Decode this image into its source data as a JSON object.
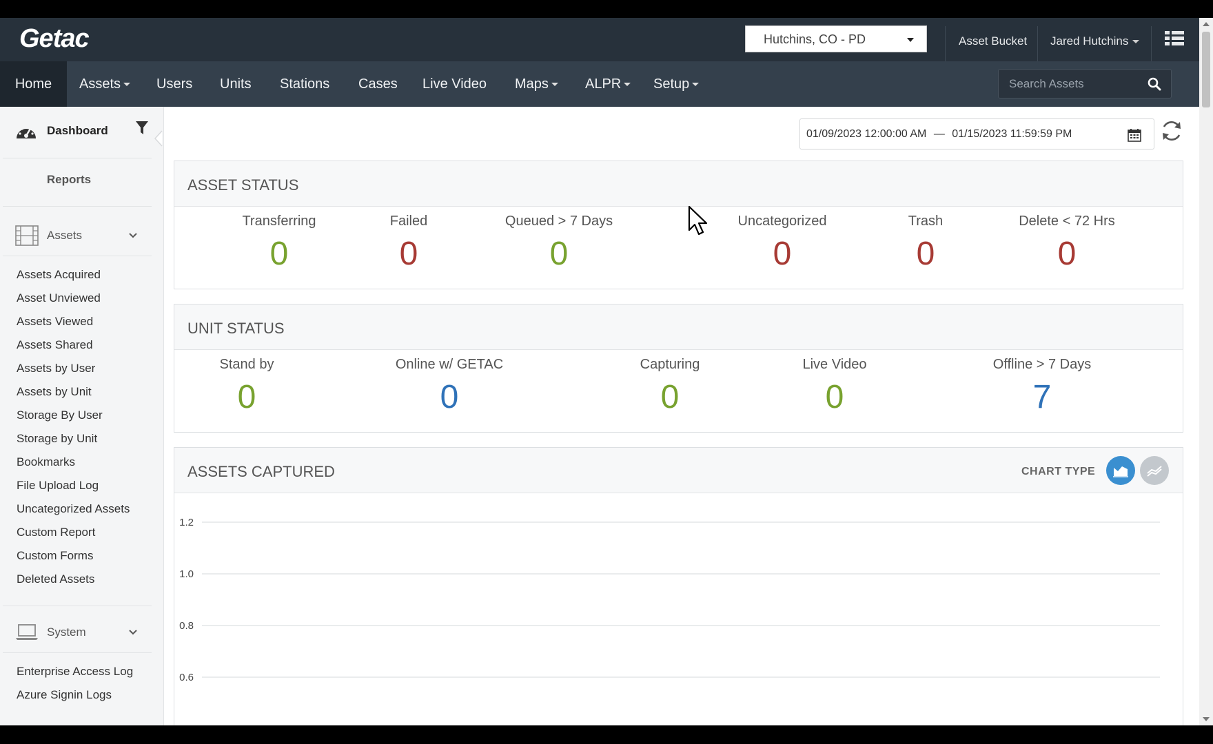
{
  "header": {
    "logo": "Getac",
    "agency": "Hutchins, CO - PD",
    "asset_bucket": "Asset Bucket",
    "user_name": "Jared Hutchins"
  },
  "nav": {
    "items": [
      {
        "label": "Home"
      },
      {
        "label": "Assets"
      },
      {
        "label": "Users"
      },
      {
        "label": "Units"
      },
      {
        "label": "Stations"
      },
      {
        "label": "Cases"
      },
      {
        "label": "Live Video"
      },
      {
        "label": "Maps"
      },
      {
        "label": "ALPR"
      },
      {
        "label": "Setup"
      }
    ],
    "search_placeholder": "Search Assets"
  },
  "sidebar": {
    "dashboard": "Dashboard",
    "reports": "Reports",
    "assets_section": "Assets",
    "asset_links": [
      "Assets Acquired",
      "Asset Unviewed",
      "Assets Viewed",
      "Assets Shared",
      "Assets by User",
      "Assets by Unit",
      "Storage By User",
      "Storage by Unit",
      "Bookmarks",
      "File Upload Log",
      "Uncategorized Assets",
      "Custom Report",
      "Custom Forms",
      "Deleted Assets"
    ],
    "system_section": "System",
    "system_links": [
      "Enterprise Access Log",
      "Azure Signin Logs"
    ]
  },
  "date_range": {
    "start": "01/09/2023 12:00:00 AM",
    "separator": "—",
    "end": "01/15/2023 11:59:59 PM"
  },
  "asset_status": {
    "title": "ASSET STATUS",
    "stats": [
      {
        "label": "Transferring",
        "value": "0",
        "color": "#78a22f"
      },
      {
        "label": "Failed",
        "value": "0",
        "color": "#a73a34"
      },
      {
        "label": "Queued > 7 Days",
        "value": "0",
        "color": "#78a22f"
      },
      {
        "label": "Uncategorized",
        "value": "0",
        "color": "#a73a34"
      },
      {
        "label": "Trash",
        "value": "0",
        "color": "#a73a34"
      },
      {
        "label": "Delete < 72 Hrs",
        "value": "0",
        "color": "#a73a34"
      }
    ]
  },
  "unit_status": {
    "title": "UNIT STATUS",
    "stats": [
      {
        "label": "Stand by",
        "value": "0",
        "color": "#78a22f"
      },
      {
        "label": "Online w/ GETAC",
        "value": "0",
        "color": "#2f72b8"
      },
      {
        "label": "Capturing",
        "value": "0",
        "color": "#78a22f"
      },
      {
        "label": "Live Video",
        "value": "0",
        "color": "#78a22f"
      },
      {
        "label": "Offline > 7 Days",
        "value": "7",
        "color": "#2f72b8"
      }
    ]
  },
  "assets_captured": {
    "title": "ASSETS CAPTURED",
    "chart_type_label": "CHART TYPE",
    "chart_types": [
      "area-chart-icon",
      "line-chart-icon"
    ]
  },
  "chart_data": {
    "type": "area",
    "title": "",
    "xlabel": "",
    "ylabel": "",
    "y_ticks": [
      "1.2",
      "1.0",
      "0.8",
      "0.6"
    ],
    "ylim": [
      0.6,
      1.2
    ],
    "grid": true,
    "series": []
  }
}
